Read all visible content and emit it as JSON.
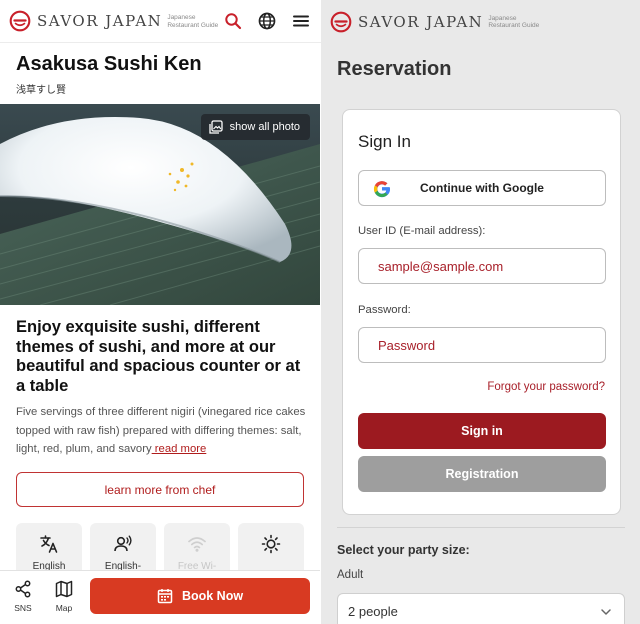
{
  "brand": {
    "name": "SAVOR JAPAN",
    "tagline_line1": "Japanese",
    "tagline_line2": "Restaurant Guide"
  },
  "restaurant": {
    "name": "Asakusa Sushi Ken",
    "name_jp": "浅草すし賢",
    "show_all_photo": "show all photo",
    "headline": "Enjoy exquisite sushi, different themes of sushi, and more at our beautiful and spacious counter or at a table",
    "description": "Five servings of three different nigiri (vinegared rice cakes topped with raw fish) prepared with differing themes: salt, light, red, plum, and savory",
    "read_more": " read more",
    "chef_button": "learn more from chef"
  },
  "features": [
    {
      "icon": "translate-icon",
      "label": "English"
    },
    {
      "icon": "english-speaking-icon",
      "label": "English-speaking"
    },
    {
      "icon": "wifi-icon",
      "label": "Free Wi-"
    },
    {
      "icon": "sun-icon",
      "label": ""
    }
  ],
  "bottom_bar": {
    "sns": "SNS",
    "map": "Map",
    "book": "Book Now"
  },
  "reservation": {
    "title": "Reservation",
    "sign_in_heading": "Sign In",
    "google_button": "Continue with Google",
    "user_id_label": "User ID (E-mail address):",
    "user_id_placeholder": "sample@sample.com",
    "password_label": "Password:",
    "password_placeholder": "Password",
    "forgot": "Forgot your password?",
    "sign_in_button": "Sign in",
    "registration_button": "Registration",
    "party_heading": "Select your party size:",
    "adult_label": "Adult",
    "adult_value": "2 people"
  },
  "colors": {
    "brand_red": "#c8202a",
    "book_now": "#d83a22",
    "sign_in": "#9c1a20",
    "registration": "#9e9e9e"
  }
}
